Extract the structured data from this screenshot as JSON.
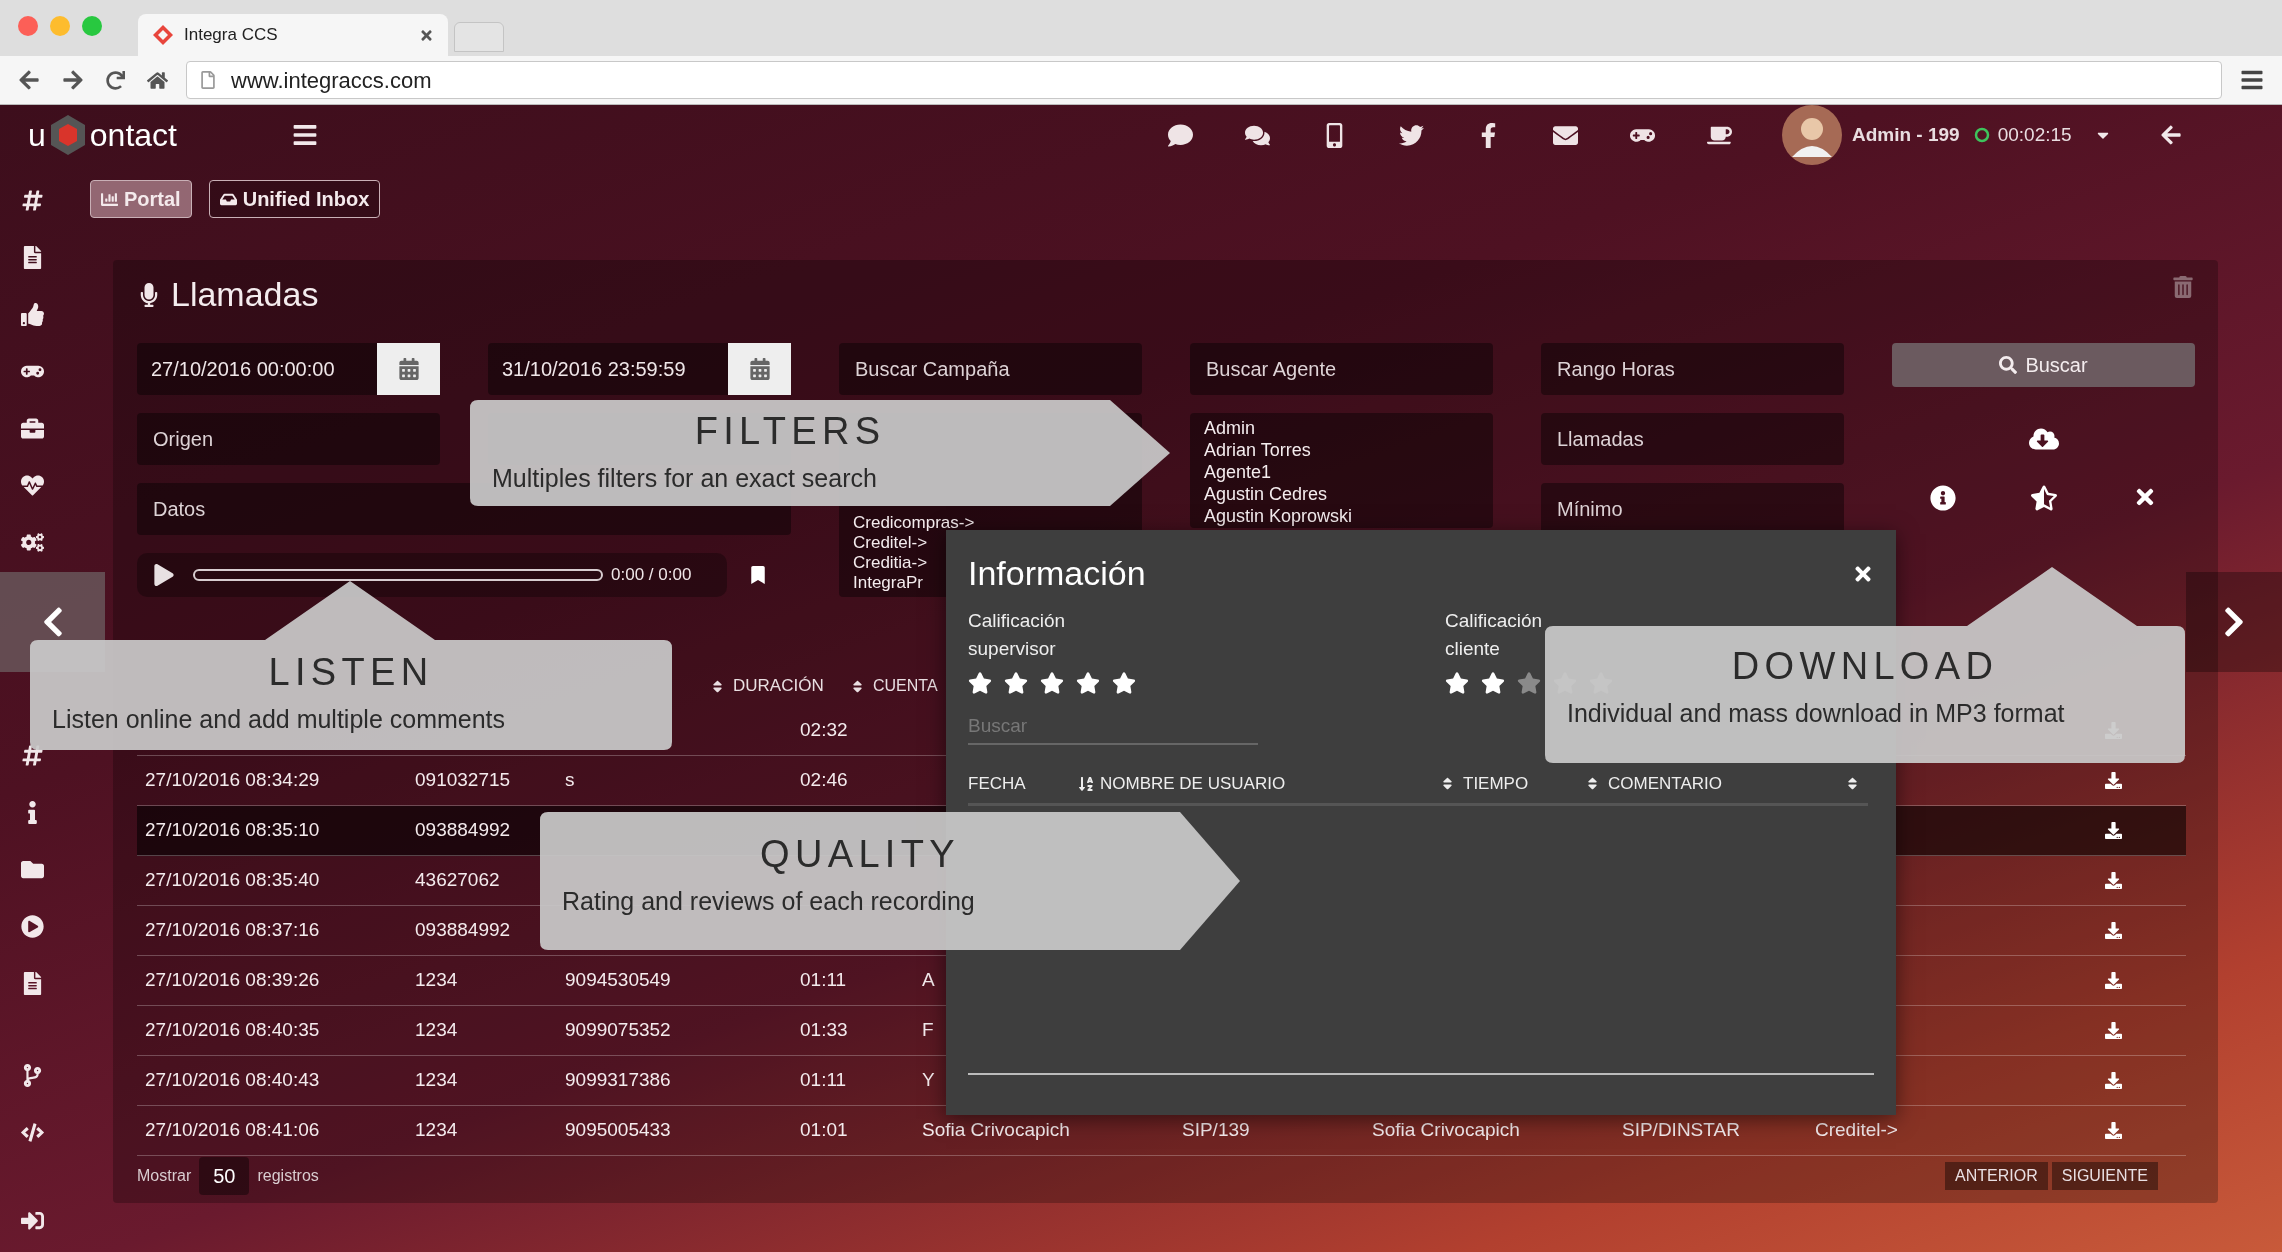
{
  "browser": {
    "tab_title": "Integra CCS",
    "url": "www.integraccs.com"
  },
  "topbar": {
    "logo": [
      "u",
      "ontact"
    ],
    "user": "Admin - 199",
    "timer": "00:02:15"
  },
  "nav_tabs": [
    {
      "label": "Portal",
      "selected": true
    },
    {
      "label": "Unified Inbox",
      "selected": false
    }
  ],
  "panel": {
    "title": "Llamadas"
  },
  "filters": {
    "date_from": "27/10/2016 00:00:00",
    "date_to": "31/10/2016 23:59:59",
    "origin": {
      "placeholder": "Origen"
    },
    "data": {
      "placeholder": "Datos"
    },
    "campaign_search": {
      "placeholder": "Buscar Campaña"
    },
    "campaigns": [
      "Credicompras->",
      "Creditel->",
      "Creditia->",
      "IntegraPr"
    ],
    "agent_search": {
      "placeholder": "Buscar Agente"
    },
    "agents": [
      "Admin",
      "Adrian Torres",
      "Agente1",
      "Agustin Cedres",
      "Agustin Koprowski"
    ],
    "hour_range": {
      "placeholder": "Rango Horas"
    },
    "calls": {
      "placeholder": "Llamadas"
    },
    "minimum": {
      "placeholder": "Mínimo"
    },
    "search_button": "Buscar"
  },
  "player": {
    "time": "0:00 / 0:00"
  },
  "table": {
    "headers": {
      "duracion": "DURACIÓN",
      "cuenta": "CUENTA"
    },
    "rows": [
      {
        "duracion": "02:32",
        "selected": false
      },
      {
        "fecha": "27/10/2016 08:34:29",
        "origen": "091032715",
        "destino": "s",
        "duracion": "02:46",
        "selected": false
      },
      {
        "fecha": "27/10/2016 08:35:10",
        "origen": "093884992",
        "selected": true
      },
      {
        "fecha": "27/10/2016 08:35:40",
        "origen": "43627062",
        "selected": false
      },
      {
        "fecha": "27/10/2016 08:37:16",
        "origen": "093884992",
        "selected": false
      },
      {
        "fecha": "27/10/2016 08:39:26",
        "origen": "1234",
        "destino": "9094530549",
        "duracion": "01:11",
        "cuenta": "A",
        "selected": false
      },
      {
        "fecha": "27/10/2016 08:40:35",
        "origen": "1234",
        "destino": "9099075352",
        "duracion": "01:33",
        "cuenta": "F",
        "selected": false
      },
      {
        "fecha": "27/10/2016 08:40:43",
        "origen": "1234",
        "destino": "9099317386",
        "duracion": "01:11",
        "cuenta": "Y",
        "selected": false
      },
      {
        "fecha": "27/10/2016 08:41:06",
        "origen": "1234",
        "destino": "9095005433",
        "duracion": "01:01",
        "cuenta": "Sofia Crivocapich",
        "extension": "SIP/139",
        "agente": "Sofia Crivocapich",
        "troncal": "SIP/DINSTAR",
        "campana": "Creditel->",
        "selected": false
      }
    ]
  },
  "pagination": {
    "show_label": "Mostrar",
    "page_size": "50",
    "records_label": "registros",
    "prev": "ANTERIOR",
    "next": "SIGUIENTE"
  },
  "modal": {
    "title": "Información",
    "ratings": [
      {
        "label": "Calificación supervisor",
        "stars": 5
      },
      {
        "label": "Calificación cliente",
        "stars": 2
      }
    ],
    "search": {
      "placeholder": "Buscar"
    },
    "columns": [
      "FECHA",
      "NOMBRE DE USUARIO",
      "TIEMPO",
      "COMENTARIO"
    ]
  },
  "callouts": [
    {
      "kind": "right",
      "title": "FILTERS",
      "text": "Multiples filters for an exact search"
    },
    {
      "kind": "up",
      "title": "LISTEN",
      "text": "Listen online and add multiple comments"
    },
    {
      "kind": "right",
      "title": "QUALITY",
      "text": "Rating and reviews of each recording"
    },
    {
      "kind": "up",
      "title": "DOWNLOAD",
      "text": "Individual and mass download in MP3 format"
    }
  ]
}
